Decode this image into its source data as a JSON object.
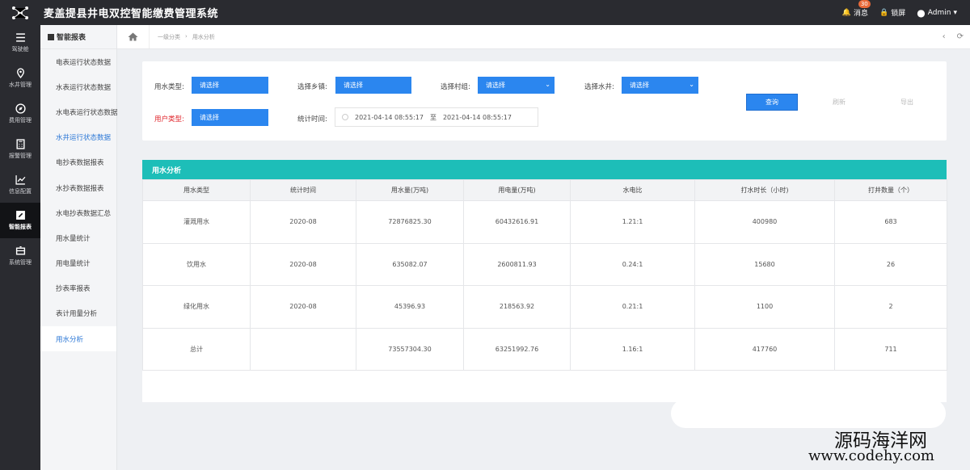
{
  "app": {
    "title": "麦盖提县井电双控智能缴费管理系统"
  },
  "topbar": {
    "messages_label": "消息",
    "messages_count": "30",
    "lock_label": "锁屏",
    "user_label": "Admin"
  },
  "iconbar": [
    {
      "label": "驾驶舱",
      "icon": "menu-icon"
    },
    {
      "label": "水井管理",
      "icon": "pin-icon"
    },
    {
      "label": "费用管理",
      "icon": "compass-icon"
    },
    {
      "label": "报警管理",
      "icon": "calculator-icon"
    },
    {
      "label": "信息配置",
      "icon": "chart-icon"
    },
    {
      "label": "智能报表",
      "icon": "edit-icon"
    },
    {
      "label": "系统管理",
      "icon": "box-icon"
    }
  ],
  "submenu": {
    "header": "智能报表",
    "items": [
      "电表运行状态数据",
      "水表运行状态数据",
      "水电表运行状态数据",
      "水井运行状态数据",
      "电抄表数据报表",
      "水抄表数据报表",
      "水电抄表数据汇总",
      "用水量统计",
      "用电量统计",
      "抄表率报表",
      "表计用量分析",
      "用水分析"
    ]
  },
  "breadcrumb": {
    "level1": "一级分类",
    "level2": "用水分析"
  },
  "filters": {
    "water_type_label": "用水类型:",
    "water_type_value": "请选择",
    "township_label": "选择乡镇:",
    "township_value": "请选择",
    "village_label": "选择村组:",
    "village_value": "请选择",
    "well_label": "选择水井:",
    "well_value": "请选择",
    "user_type_label": "用户类型:",
    "user_type_value": "请选择",
    "time_label": "统计时间:",
    "start_time": "2021-04-14 08:55:17",
    "separator": "至",
    "end_time": "2021-04-14 08:55:17",
    "query_label": "查询",
    "reset_label": "刷新",
    "export_label": "导出"
  },
  "result": {
    "title": "用水分析",
    "columns": [
      "用水类型",
      "统计时间",
      "用水量(万吨)",
      "用电量(万吨)",
      "水电比",
      "打水时长（小时)",
      "打井数量（个）"
    ],
    "rows": [
      [
        "灌溉用水",
        "2020-08",
        "72876825.30",
        "60432616.91",
        "1.21:1",
        "400980",
        "683"
      ],
      [
        "饮用水",
        "2020-08",
        "635082.07",
        "2600811.93",
        "0.24:1",
        "15680",
        "26"
      ],
      [
        "绿化用水",
        "2020-08",
        "45396.93",
        "218563.92",
        "0.21:1",
        "1100",
        "2"
      ],
      [
        "总计",
        "",
        "73557304.30",
        "63251992.76",
        "1.16:1",
        "417760",
        "711"
      ]
    ]
  },
  "watermark": {
    "line1": "源码海洋网",
    "line2": "www.codehy.com"
  }
}
